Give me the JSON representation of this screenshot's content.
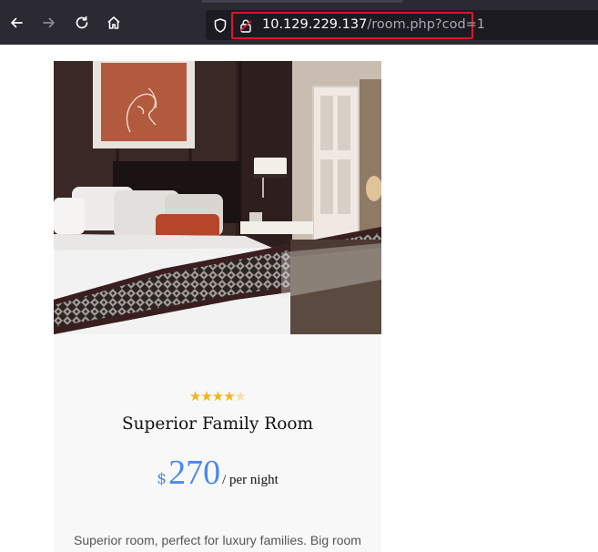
{
  "browser": {
    "url_host": "10.129.229.137",
    "url_path": "/room.php?cod=1",
    "icons": {
      "back": "arrow-left-icon",
      "forward": "arrow-right-icon",
      "reload": "reload-icon",
      "home": "home-icon",
      "tracking": "shield-icon",
      "security": "lock-icon"
    },
    "forward_enabled": false
  },
  "room": {
    "rating": 4,
    "rating_max": 5,
    "stars": [
      "★",
      "★",
      "★",
      "★",
      "★"
    ],
    "title": "Superior Family Room",
    "currency": "$",
    "price": "270",
    "per_label": "/ per night",
    "description": "Superior room, perfect for luxury families. Big room with a lot of extras"
  },
  "colors": {
    "accent": "#4a8ae8",
    "star": "#f3b41e",
    "highlight": "#e0132e"
  }
}
